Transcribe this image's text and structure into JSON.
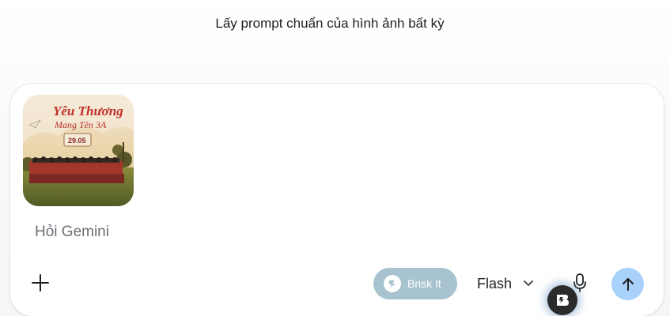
{
  "prompt": {
    "text": "Lấy prompt chuẩn của hình ảnh bất kỳ"
  },
  "composer": {
    "attachment": {
      "title_line1": "Yêu Thương",
      "title_line2": "Mang Tên 3A",
      "date_label": "29.05"
    },
    "input_placeholder": "Hỏi Gemini",
    "brisk_label": "Brisk It",
    "model_label": "Flash"
  },
  "icons": {
    "add": "plus-icon",
    "brisk": "brisk-logo-icon",
    "model_dropdown": "chevron-down-icon",
    "mic": "microphone-icon",
    "send": "arrow-up-icon",
    "floating": "brisk-floating-icon"
  },
  "colors": {
    "brisk_button": "#a7c3cf",
    "send_button": "#a8d1fb",
    "floating_button": "#2b2b2b"
  }
}
